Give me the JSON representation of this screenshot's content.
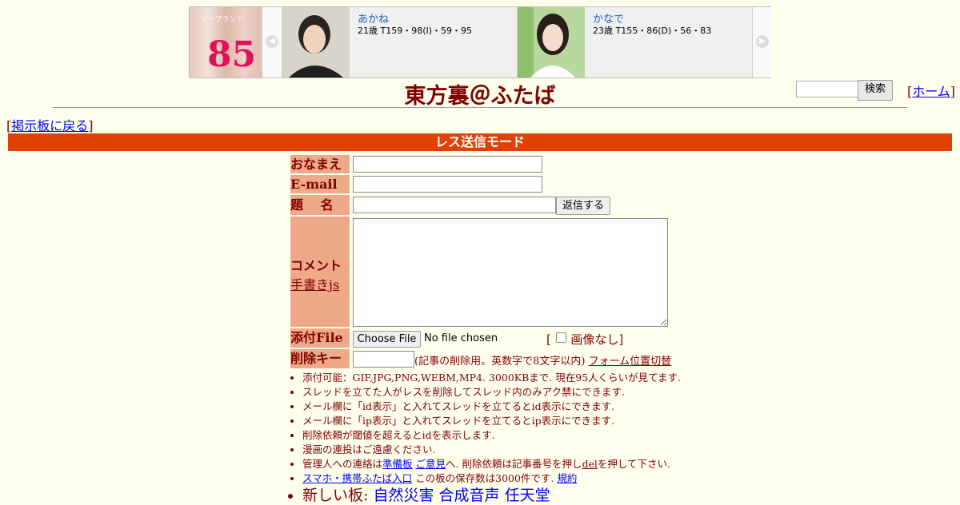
{
  "banner": {
    "logo_number": "85",
    "logo_caption": "ソープランド",
    "prev_arrow": "◀",
    "next_arrow": "▶",
    "profiles": [
      {
        "name": "あかね",
        "stats": "21歳 T159・98(I)・59・95"
      },
      {
        "name": "かなで",
        "stats": "23歳 T155・86(D)・56・83"
      }
    ]
  },
  "header": {
    "title": "東方裏＠ふたば",
    "search_button": "検索",
    "search_value": "",
    "home_prefix": "[",
    "home_label": "ホーム",
    "home_suffix": "]"
  },
  "nav": {
    "back_prefix": "[",
    "back_label": "掲示板に戻る",
    "back_suffix": "]"
  },
  "mode_bar": "レス送信モード",
  "form": {
    "name_label": "おなまえ",
    "email_label": "E-mail",
    "subject_label": "題　 名",
    "submit_button": "返信する",
    "comment_label": "コメント",
    "handwriting_link": "手書きjs",
    "file_label": "添付File",
    "choose_file_button": "Choose File",
    "no_file_text": "No file chosen",
    "no_image_prefix": "[",
    "no_image_label": "画像なし]",
    "delete_key_label": "削除キー",
    "delete_key_note": "(記事の削除用。英数字で8文字以内)",
    "form_position_link": "フォーム位置切替"
  },
  "rules": {
    "line1": "添付可能：GIF,JPG,PNG,WEBM,MP4. 3000KBまで. 現在95人くらいが見てます.",
    "line2": "スレッドを立てた人がレスを削除してスレッド内のみアク禁にできます.",
    "line3": "メール欄に「id表示」と入れてスレッドを立てるとid表示にできます.",
    "line4": "メール欄に「ip表示」と入れてスレッドを立てるとip表示にできます.",
    "line5": "削除依頼が閾値を超えるとidを表示します.",
    "line6": "漫画の連投はご遠慮ください.",
    "line7_prefix": "管理人への連絡は",
    "line7_link1": "準備板",
    "line7_link2": "ご意見",
    "line7_mid": "へ. 削除依頼は記事番号を押し",
    "line7_link3": "del",
    "line7_suffix": "を押して下さい.",
    "line8_link": "スマホ・携帯ふたば入口",
    "line8_text": " この板の保存数は3000件です.",
    "line8_link2": "規約",
    "line9_prefix": "新しい板: ",
    "line9_links": [
      "自然災害",
      "合成音声",
      "任天堂"
    ]
  },
  "colors": {
    "background": "#ffffee",
    "text": "#800000",
    "mode_bar": "#e04000",
    "label_bg": "#eeaa88",
    "link": "#0000ee"
  }
}
